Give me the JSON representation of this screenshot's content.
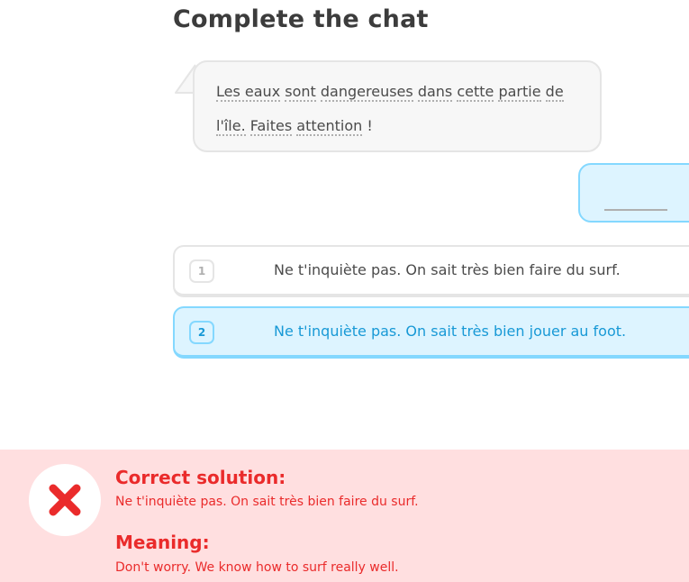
{
  "challenge": {
    "title": "Complete the chat"
  },
  "chat": {
    "prompt_words": [
      "Les eaux",
      "sont",
      "dangereuses",
      "dans",
      "cette",
      "partie",
      "de",
      "l'île.",
      "Faites",
      "attention",
      "!"
    ],
    "reply_blank": ""
  },
  "options": [
    {
      "number": "1",
      "text": "Ne t'inquiète pas. On sait très bien faire du surf.",
      "selected": false
    },
    {
      "number": "2",
      "text": "Ne t'inquiète pas. On sait très bien jouer au foot.",
      "selected": true
    }
  ],
  "feedback": {
    "status": "incorrect",
    "icon": "x-mark-icon",
    "solution_heading": "Correct solution:",
    "solution_text": "Ne t'inquiète pas. On sait très bien faire du surf.",
    "meaning_heading": "Meaning:",
    "meaning_text": "Don't worry. We know how to surf really well."
  },
  "colors": {
    "selected_accent": "#1899d6",
    "selected_bg": "#ddf4ff",
    "error_red": "#ea2b2b",
    "error_bg": "#ffdfe0"
  }
}
